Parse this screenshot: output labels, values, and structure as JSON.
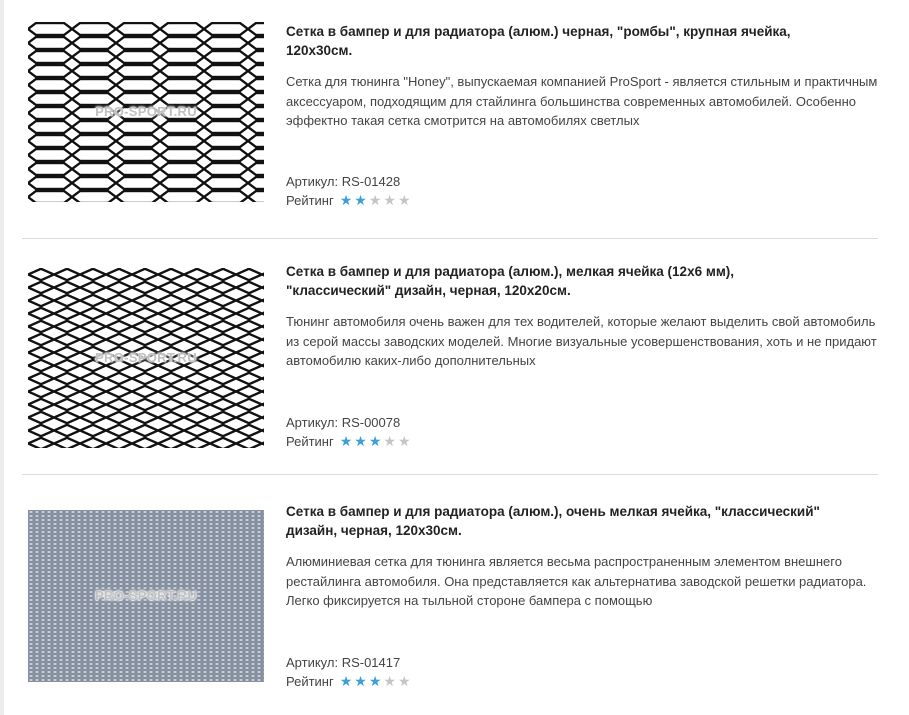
{
  "watermark": "PRO-SPORT.RU",
  "colors": {
    "star_active": "#3b9fd8",
    "star_inactive": "#c5c5c5",
    "divider": "#dcdcdc"
  },
  "products": [
    {
      "title_line1": "Сетка в бампер и для радиатора (алюм.) черная, \"ромбы\", крупная ячейка,",
      "title_line2": "120x30см.",
      "description": "Сетка для тюнинга \"Honey\", выпускаемая компанией ProSport - является стильным и практичным аксессуаром, подходящим для стайлинга большинства современных автомобилей. Особенно эффектно такая сетка смотрится на автомобилях светлых",
      "sku": "Артикул: RS-01428",
      "rating_label": "Рейтинг",
      "rating": 2,
      "rating_max": 5,
      "image_icon": "honeycomb-mesh-image"
    },
    {
      "title_line1": "Сетка в бампер и для радиатора (алюм.), мелкая ячейка (12x6 мм),",
      "title_line2": "\"классический\" дизайн, черная, 120x20см.",
      "description": "Тюнинг автомобиля очень важен для тех водителей, которые желают выделить свой автомобиль из серой массы заводских моделей. Многие визуальные усовершенствования, хоть и не придают автомобилю каких-либо дополнительных",
      "sku": "Артикул: RS-00078",
      "rating_label": "Рейтинг",
      "rating": 3,
      "rating_max": 5,
      "image_icon": "diamond-mesh-image"
    },
    {
      "title_line1": "Сетка в бампер и для радиатора (алюм.), очень мелкая ячейка, \"классический\"",
      "title_line2": "дизайн, черная, 120x30см.",
      "description": "Алюминиевая сетка для тюнинга является весьма распространенным элементом внешнего рестайлинга автомобиля. Она представляется как альтернатива заводской решетки радиатора. Легко фиксируется на тыльной стороне бампера с помощью",
      "sku": "Артикул: RS-01417",
      "rating_label": "Рейтинг",
      "rating": 3,
      "rating_max": 5,
      "image_icon": "fine-mesh-image"
    }
  ]
}
